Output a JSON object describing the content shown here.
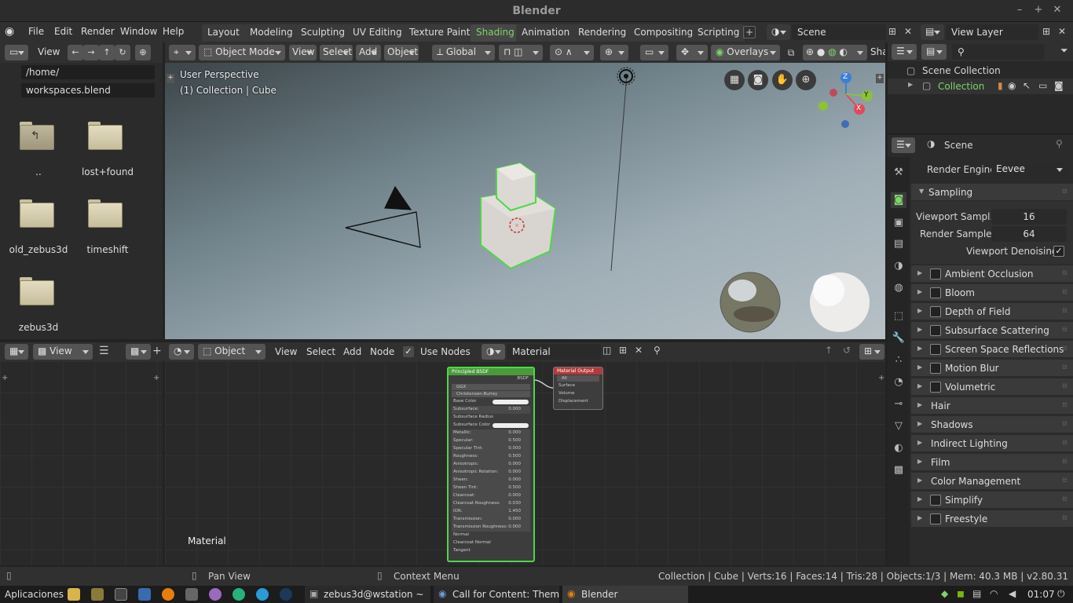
{
  "window": {
    "title": "Blender",
    "min": "–",
    "max": "+",
    "close": "✕"
  },
  "menus": [
    "File",
    "Edit",
    "Render",
    "Window",
    "Help"
  ],
  "workspaces": [
    "Layout",
    "Modeling",
    "Sculpting",
    "UV Editing",
    "Texture Paint",
    "Shading",
    "Animation",
    "Rendering",
    "Compositing",
    "Scripting"
  ],
  "active_workspace": "Shading",
  "scene": "Scene",
  "view_layer": "View Layer",
  "filebrowser": {
    "view_menu": "View",
    "path": "/home/",
    "filename": "workspaces.blend",
    "items": [
      "..",
      "lost+found",
      "old_zebus3d",
      "timeshift",
      "zebus3d"
    ]
  },
  "viewport": {
    "mode": "Object Mode",
    "menus": [
      "View",
      "Select",
      "Add",
      "Object"
    ],
    "transform": "Global",
    "overlays": "Overlays",
    "shading": "Sha",
    "info1": "User Perspective",
    "info2": "(1) Collection | Cube",
    "axes": {
      "x": "X",
      "y": "Y",
      "z": "Z"
    }
  },
  "node_editor": {
    "view_label": "View",
    "object_dd": "Object",
    "menus": [
      "View",
      "Select",
      "Add",
      "Node"
    ],
    "use_nodes": "Use Nodes",
    "material": "Material",
    "canvas_label": "Material",
    "bsdf": {
      "title": "Principled BSDF",
      "output": "BSDF",
      "dist": "GGX",
      "sss": "Christensen-Burley",
      "rows": [
        [
          "Base Color",
          ""
        ],
        [
          "Subsurface:",
          "0.000"
        ],
        [
          "Subsurface Radius",
          ""
        ],
        [
          "Subsurface Color",
          ""
        ],
        [
          "Metallic:",
          "0.000"
        ],
        [
          "Specular:",
          "0.500"
        ],
        [
          "Specular Tint:",
          "0.000"
        ],
        [
          "Roughness:",
          "0.500"
        ],
        [
          "Anisotropic:",
          "0.000"
        ],
        [
          "Anisotropic Rotation:",
          "0.000"
        ],
        [
          "Sheen:",
          "0.000"
        ],
        [
          "Sheen Tint:",
          "0.500"
        ],
        [
          "Clearcoat:",
          "0.000"
        ],
        [
          "Clearcoat Roughness:",
          "0.030"
        ],
        [
          "IOR:",
          "1.450"
        ],
        [
          "Transmission:",
          "0.000"
        ],
        [
          "Transmission Roughness:",
          "0.000"
        ],
        [
          "Normal",
          ""
        ],
        [
          "Clearcoat Normal",
          ""
        ],
        [
          "Tangent",
          ""
        ]
      ]
    },
    "output": {
      "title": "Material Output",
      "target": "All",
      "rows": [
        "Surface",
        "Volume",
        "Displacement"
      ]
    }
  },
  "outliner": {
    "root": "Scene Collection",
    "collection": "Collection"
  },
  "properties": {
    "context": "Scene",
    "engine_label": "Render Engine",
    "engine": "Eevee",
    "sampling": "Sampling",
    "viewport_samples_label": "Viewport Sampl..",
    "viewport_samples": "16",
    "render_samples_label": "Render Samples",
    "render_samples": "64",
    "denoise_label": "Viewport Denoising",
    "panels": [
      {
        "label": "Ambient Occlusion",
        "cb": true
      },
      {
        "label": "Bloom",
        "cb": true
      },
      {
        "label": "Depth of Field",
        "cb": true
      },
      {
        "label": "Subsurface Scattering",
        "cb": true
      },
      {
        "label": "Screen Space Reflections",
        "cb": true
      },
      {
        "label": "Motion Blur",
        "cb": true
      },
      {
        "label": "Volumetric",
        "cb": true
      },
      {
        "label": "Hair",
        "cb": false
      },
      {
        "label": "Shadows",
        "cb": false
      },
      {
        "label": "Indirect Lighting",
        "cb": false
      },
      {
        "label": "Film",
        "cb": false
      },
      {
        "label": "Color Management",
        "cb": false
      },
      {
        "label": "Simplify",
        "cb": true
      },
      {
        "label": "Freestyle",
        "cb": true
      }
    ]
  },
  "status": {
    "left": "Pan View",
    "middle": "Context Menu",
    "right": "Collection | Cube | Verts:16 | Faces:14 | Tris:28 | Objects:1/3 | Mem: 40.3 MB | v2.80.31"
  },
  "taskbar": {
    "apps": "Aplicaciones",
    "t1": "zebus3d@wstation ~",
    "t2": "Call for Content: Themes...",
    "t3": "Blender",
    "clock": "01:07"
  },
  "colors": {
    "accent": "#7fd36a",
    "selected": "#4fd64a"
  }
}
